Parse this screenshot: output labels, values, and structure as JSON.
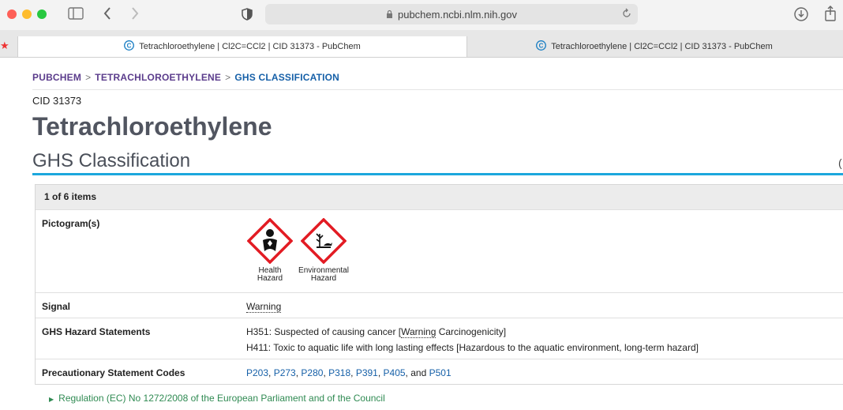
{
  "browser": {
    "url": "pubchem.ncbi.nlm.nih.gov",
    "tabs": [
      {
        "label": "Tetrachloroethylene | Cl2C=CCl2 | CID 31373 - PubChem"
      },
      {
        "label": "Tetrachloroethylene | Cl2C=CCl2 | CID 31373 - PubChem"
      }
    ]
  },
  "breadcrumb": {
    "items": [
      "PUBCHEM",
      "TETRACHLOROETHYLENE",
      "GHS CLASSIFICATION"
    ],
    "separator": ">"
  },
  "page": {
    "cid": "CID 31373",
    "title": "Tetrachloroethylene",
    "section": "GHS Classification"
  },
  "table": {
    "header": "1 of 6 items",
    "pictogram_label": "Pictogram(s)",
    "pictograms": [
      {
        "line1": "Health",
        "line2": "Hazard",
        "icon": "health-hazard-icon"
      },
      {
        "line1": "Environmental",
        "line2": "Hazard",
        "icon": "environment-icon"
      }
    ],
    "signal_label": "Signal",
    "signal_value": "Warning",
    "hazard_label": "GHS Hazard Statements",
    "h351_prefix": "H351: Suspected of causing cancer [",
    "h351_warning": "Warning",
    "h351_suffix": " Carcinogenicity]",
    "h411": "H411: Toxic to aquatic life with long lasting effects [Hazardous to the aquatic environment, long-term hazard]",
    "precaution_label": "Precautionary Statement Codes",
    "codes": [
      "P203",
      "P273",
      "P280",
      "P318",
      "P391",
      "P405"
    ],
    "last_code": "P501",
    "and_text": "and"
  },
  "regulation": "Regulation (EC) No 1272/2008 of the European Parliament and of the Council",
  "colors": {
    "breadcrumb_purple": "#5b3c8c",
    "breadcrumb_blue": "#1660a8",
    "section_line": "#1ca7dd",
    "regulation_green": "#2f8a52",
    "ghs_red": "#e21b23"
  }
}
